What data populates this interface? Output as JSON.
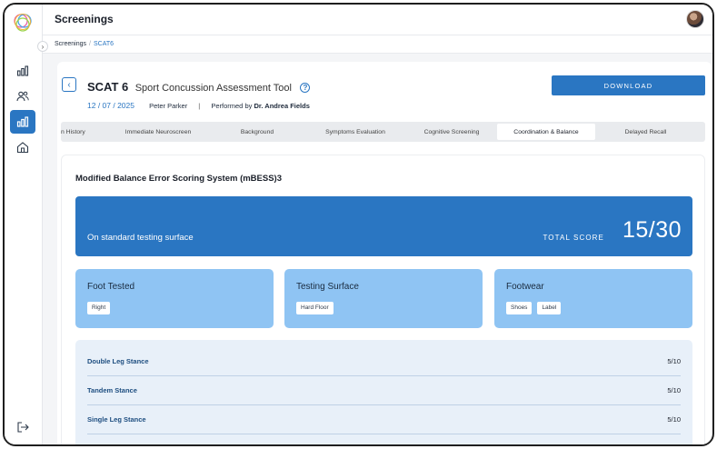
{
  "app": {
    "title": "Screenings"
  },
  "breadcrumb": {
    "root": "Screenings",
    "separator": "/",
    "current": "SCAT6"
  },
  "sidebar": {
    "items": [
      {
        "name": "dashboard",
        "icon": "bar-chart-icon"
      },
      {
        "name": "users",
        "icon": "users-icon"
      },
      {
        "name": "screenings",
        "icon": "bar-chart-icon",
        "active": true
      },
      {
        "name": "home",
        "icon": "home-icon"
      }
    ],
    "logout_icon": "logout-icon"
  },
  "header": {
    "title": "SCAT 6",
    "subtitle": "Sport Concussion Assessment Tool",
    "date": "12 / 07 / 2025",
    "patient": "Peter Parker",
    "divider": "|",
    "performed_prefix": "Performed by",
    "performed_by": "Dr. Andrea Fields",
    "download_label": "DOWNLOAD"
  },
  "tabs": [
    {
      "label": "n History"
    },
    {
      "label": "Immediate Neuroscreen"
    },
    {
      "label": "Background"
    },
    {
      "label": "Symptoms Evaluation"
    },
    {
      "label": "Cognitive Screening"
    },
    {
      "label": "Coordination & Balance",
      "active": true
    },
    {
      "label": "Delayed Recall"
    }
  ],
  "section": {
    "title": "Modified Balance Error Scoring System (mBESS)3",
    "banner": {
      "label": "On standard testing surface",
      "total_label": "TOTAL SCORE",
      "total_value": "15/30"
    },
    "cards": [
      {
        "title": "Foot Tested",
        "chips": [
          "Right"
        ]
      },
      {
        "title": "Testing Surface",
        "chips": [
          "Hard Floor"
        ]
      },
      {
        "title": "Footwear",
        "chips": [
          "Shoes",
          "Label"
        ]
      }
    ],
    "stances": [
      {
        "label": "Double Leg Stance",
        "score": "5/10"
      },
      {
        "label": "Tandem Stance",
        "score": "5/10"
      },
      {
        "label": "Single Leg Stance",
        "score": "5/10"
      }
    ]
  },
  "colors": {
    "accent": "#2a76c2",
    "card": "#8fc4f3",
    "panel": "#e8f0f9"
  }
}
